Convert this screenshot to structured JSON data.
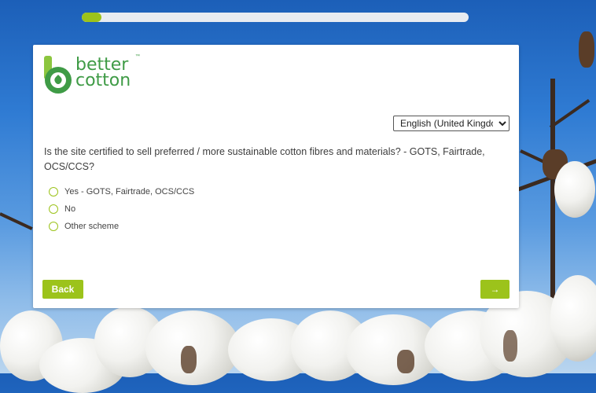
{
  "progress": {
    "value": 0.05
  },
  "brand": {
    "line1": "better",
    "line2": "cotton",
    "trademark": "™"
  },
  "language": {
    "selected": "English (United Kingdom)"
  },
  "question": {
    "text": "Is the site certified to sell preferred / more sustainable cotton fibres and materials? - GOTS, Fairtrade, OCS/CCS?"
  },
  "options": [
    {
      "label": "Yes - GOTS, Fairtrade, OCS/CCS"
    },
    {
      "label": "No"
    },
    {
      "label": "Other scheme"
    }
  ],
  "nav": {
    "back_label": "Back",
    "next_label": "→"
  },
  "colors": {
    "accent": "#9cc31b",
    "brand_green": "#3f9b46",
    "sky": "#2f7bd3"
  }
}
